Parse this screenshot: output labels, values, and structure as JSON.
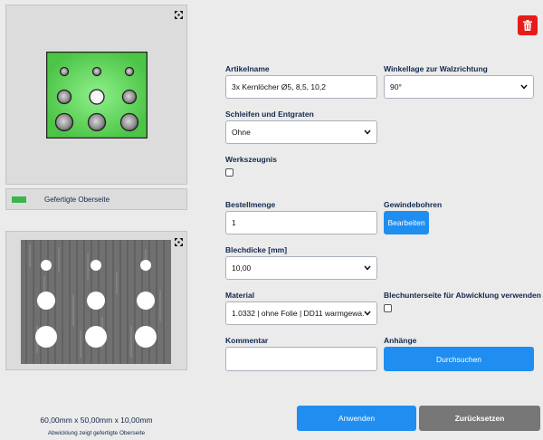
{
  "preview": {
    "expand_icon": "expand-icon",
    "legend_color": "#3bb54a",
    "legend_label": "Gefertigte Oberseite"
  },
  "unfold": {
    "expand_icon": "expand-icon",
    "dimensions": "60,00mm x 50,00mm x 10,00mm",
    "note": "Abwicklung zeigt gefertigte Oberseite"
  },
  "delete_icon": "trash-icon",
  "form": {
    "artikelname": {
      "label": "Artikelname",
      "value": "3x Kernlöcher Ø5, 8,5, 10,2"
    },
    "winkellage": {
      "label": "Winkellage zur Walzrichtung",
      "value": "90°"
    },
    "schleifen": {
      "label": "Schleifen und Entgraten",
      "value": "Ohne"
    },
    "werkszeugnis": {
      "label": "Werkszeugnis"
    },
    "bestellmenge": {
      "label": "Bestellmenge",
      "value": "1"
    },
    "gewindebohren": {
      "label": "Gewindebohren",
      "button": "Bearbeiten"
    },
    "blechdicke": {
      "label": "Blechdicke [mm]",
      "value": "10,00"
    },
    "material": {
      "label": "Material",
      "value": "1.0332 | ohne Folie | DD11 warmgewa..."
    },
    "blechunterseite": {
      "label": "Blechunterseite für Abwicklung verwenden"
    },
    "kommentar": {
      "label": "Kommentar",
      "value": ""
    },
    "anhaenge": {
      "label": "Anhänge",
      "button": "Durchsuchen"
    }
  },
  "actions": {
    "apply": "Anwenden",
    "reset": "Zurücksetzen"
  },
  "colors": {
    "accent": "#1f8ef0",
    "danger": "#e81b1b",
    "part_green": "#5fd35a"
  }
}
